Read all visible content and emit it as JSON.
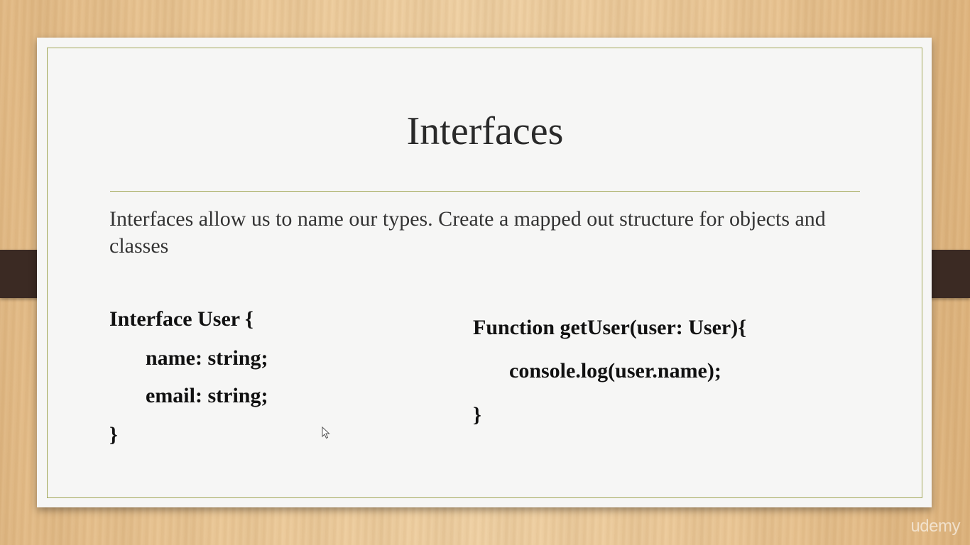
{
  "slide": {
    "title": "Interfaces",
    "intro": "Interfaces allow us to name our types. Create a mapped out structure for objects and classes",
    "left_code": [
      "Interface User {",
      "name: string;",
      "email: string;",
      "}"
    ],
    "right_code": [
      "Function getUser(user: User){",
      "console.log(user.name);",
      "}"
    ]
  },
  "watermark": "udemy",
  "icons": {
    "cursor": "mouse-pointer-icon"
  }
}
